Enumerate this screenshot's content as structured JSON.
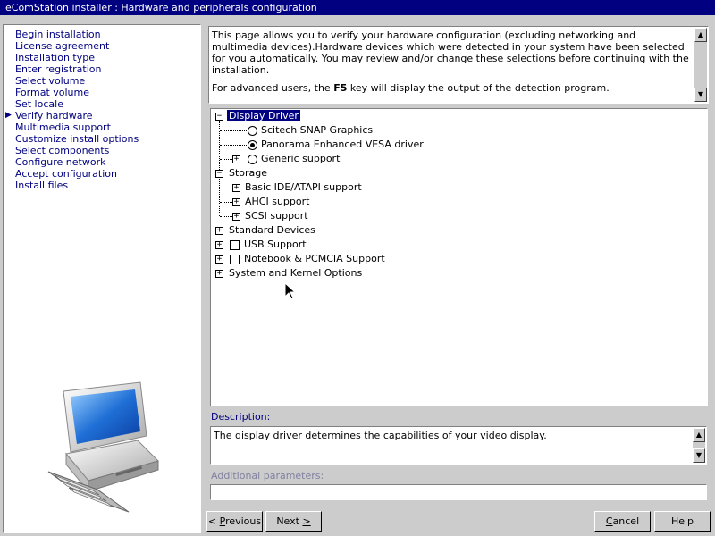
{
  "window": {
    "title": "eComStation installer : Hardware and peripherals configuration"
  },
  "sidebar": {
    "steps": [
      {
        "label": "Begin installation"
      },
      {
        "label": "License agreement"
      },
      {
        "label": "Installation type"
      },
      {
        "label": "Enter registration"
      },
      {
        "label": "Select volume"
      },
      {
        "label": "Format volume"
      },
      {
        "label": "Set locale"
      },
      {
        "label": "Verify hardware",
        "current": true
      },
      {
        "label": "Multimedia support"
      },
      {
        "label": "Customize install options"
      },
      {
        "label": "Select components"
      },
      {
        "label": "Configure network"
      },
      {
        "label": "Accept configuration"
      },
      {
        "label": "Install files"
      }
    ]
  },
  "intro": {
    "paragraph1": "This page allows you to verify your hardware configuration (excluding networking and multimedia devices).Hardware devices which were detected in your system have been selected for you automatically.  You may review and/or change these selections before continuing with the installation.",
    "paragraph2_before": "For advanced users, the ",
    "paragraph2_key": "F5",
    "paragraph2_after": " key will display the output of the detection program."
  },
  "tree": {
    "display_driver": "Display Driver",
    "scitech": "Scitech SNAP Graphics",
    "panorama": "Panorama Enhanced VESA driver",
    "generic": "Generic support",
    "storage": "Storage",
    "ide": "Basic IDE/ATAPI support",
    "ahci": "AHCI support",
    "scsi": "SCSI support",
    "standard": "Standard Devices",
    "usb": "USB Support",
    "notebook": "Notebook & PCMCIA Support",
    "system": "System and Kernel Options"
  },
  "description": {
    "label": "Description:",
    "text": "The display driver determines the capabilities of your video display."
  },
  "additional": {
    "label": "Additional parameters:",
    "value": ""
  },
  "buttons": {
    "previous_u": "P",
    "previous_rest": "revious",
    "next_pre": "Next ",
    "next_u": ">",
    "cancel_u": "C",
    "cancel_rest": "ancel",
    "help": "Help"
  },
  "colors": {
    "titlebar": "#000080",
    "link": "#000080",
    "face": "#cccccc"
  }
}
